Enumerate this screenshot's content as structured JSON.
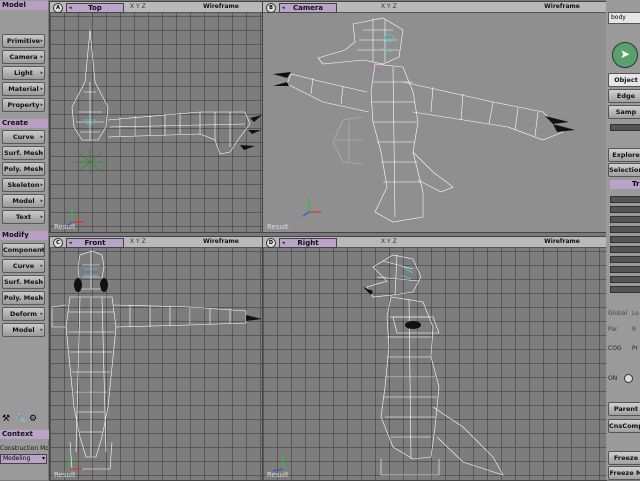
{
  "left_panel": {
    "sections": [
      {
        "title": "Model",
        "buttons": [
          "Primitive",
          "Camera",
          "Light",
          "Material",
          "Property"
        ]
      },
      {
        "title": "Create",
        "buttons": [
          "Curve",
          "Surf. Mesh",
          "Poly. Mesh",
          "Skeleton",
          "Model",
          "Text"
        ]
      },
      {
        "title": "Modify",
        "buttons": [
          "Component",
          "Curve",
          "Surf. Mesh",
          "Poly. Mesh",
          "Deform",
          "Model"
        ]
      }
    ],
    "context_label": "Context",
    "construction_mode": "Construction Mode",
    "mode_value": "Modeling"
  },
  "viewports": [
    {
      "letter": "A",
      "name": "Top",
      "shading": "Wireframe",
      "status": "Result"
    },
    {
      "letter": "B",
      "name": "Camera",
      "shading": "Wireframe",
      "status": "Result"
    },
    {
      "letter": "C",
      "name": "Front",
      "shading": "Wireframe",
      "status": "Result"
    },
    {
      "letter": "D",
      "name": "Right",
      "shading": "Wireframe",
      "status": "Result"
    }
  ],
  "viewport_icons": "X Y Z",
  "right_panel": {
    "object_name": "body",
    "buttons": [
      "Object",
      "Edge",
      "Samp",
      "Explore",
      "Selection",
      "Parent",
      "CnsComp",
      "Freeze",
      "Freeze M"
    ],
    "tab_label": "Tr",
    "labels": [
      "Global",
      "Lo",
      "Par",
      "R",
      "COG",
      "Pr",
      "ON"
    ]
  },
  "colors": {
    "selection_wire": "#ffffff",
    "accent": "#b9a3c8",
    "cyan_mark": "#3fd0e0"
  }
}
